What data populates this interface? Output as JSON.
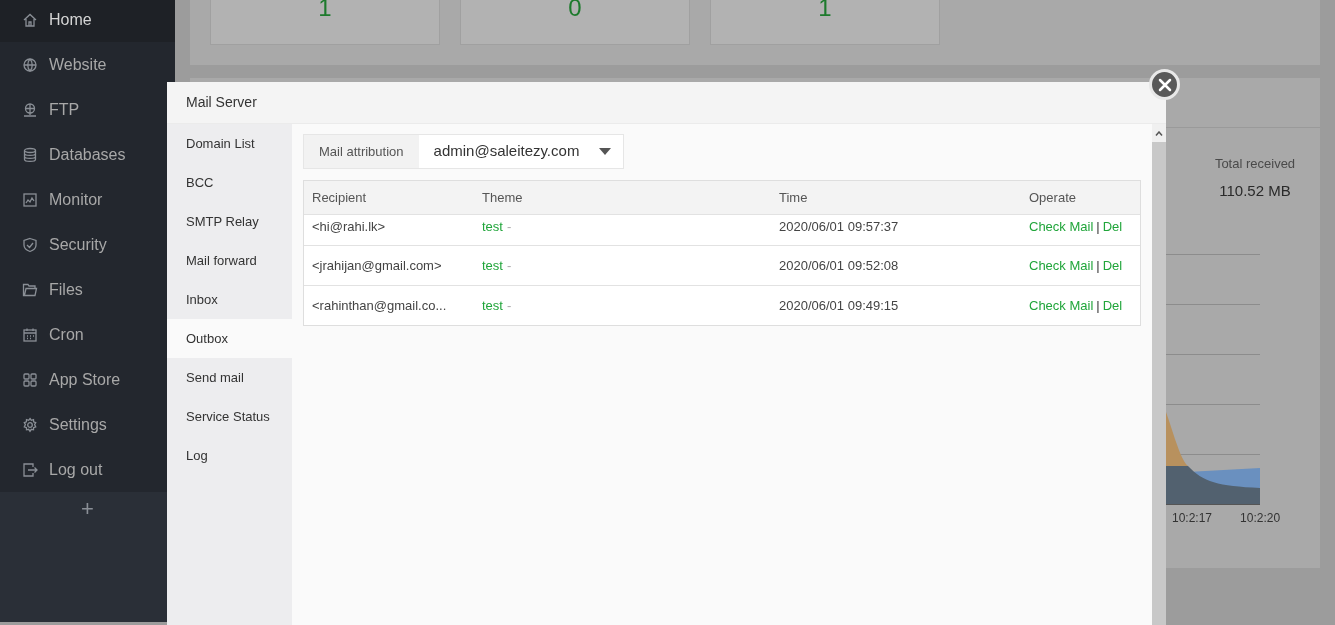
{
  "sidebar": {
    "items": [
      {
        "label": "Home",
        "selected": true
      },
      {
        "label": "Website",
        "selected": false
      },
      {
        "label": "FTP",
        "selected": false
      },
      {
        "label": "Databases",
        "selected": false
      },
      {
        "label": "Monitor",
        "selected": false
      },
      {
        "label": "Security",
        "selected": false
      },
      {
        "label": "Files",
        "selected": false
      },
      {
        "label": "Cron",
        "selected": false
      },
      {
        "label": "App Store",
        "selected": false
      },
      {
        "label": "Settings",
        "selected": false
      },
      {
        "label": "Log out",
        "selected": false
      }
    ],
    "add_label": "+"
  },
  "stat_cards": [
    {
      "value": "1"
    },
    {
      "value": "0"
    },
    {
      "value": "1"
    }
  ],
  "traffic": {
    "total_received_label": "Total received",
    "total_received": "110.52 MB",
    "x_labels": [
      "10:2:17",
      "10:2:20"
    ]
  },
  "dialog": {
    "title": "Mail Server",
    "menu": [
      {
        "label": "Domain List",
        "selected": false
      },
      {
        "label": "BCC",
        "selected": false
      },
      {
        "label": "SMTP Relay",
        "selected": false
      },
      {
        "label": "Mail forward",
        "selected": false
      },
      {
        "label": "Inbox",
        "selected": false
      },
      {
        "label": "Outbox",
        "selected": true
      },
      {
        "label": "Send mail",
        "selected": false
      },
      {
        "label": "Service Status",
        "selected": false
      },
      {
        "label": "Log",
        "selected": false
      }
    ],
    "attribution": {
      "label": "Mail attribution",
      "value": "admin@saleitezy.com"
    },
    "table": {
      "columns": [
        "Recipient",
        "Theme",
        "Time",
        "Operate"
      ],
      "rows": [
        {
          "recipient": "<hi@rahi.lk>",
          "theme": "test",
          "theme_suffix": "-",
          "time": "2020/06/01 09:57:37",
          "actions": [
            "Check Mail",
            "Del"
          ],
          "separator": "|"
        },
        {
          "recipient": "<jrahijan@gmail.com>",
          "theme": "test",
          "theme_suffix": "-",
          "time": "2020/06/01 09:52:08",
          "actions": [
            "Check Mail",
            "Del"
          ],
          "separator": "|"
        },
        {
          "recipient": "<rahinthan@gmail.co...",
          "theme": "test",
          "theme_suffix": "-",
          "time": "2020/06/01 09:49:15",
          "actions": [
            "Check Mail",
            "Del"
          ],
          "separator": "|"
        }
      ]
    }
  }
}
